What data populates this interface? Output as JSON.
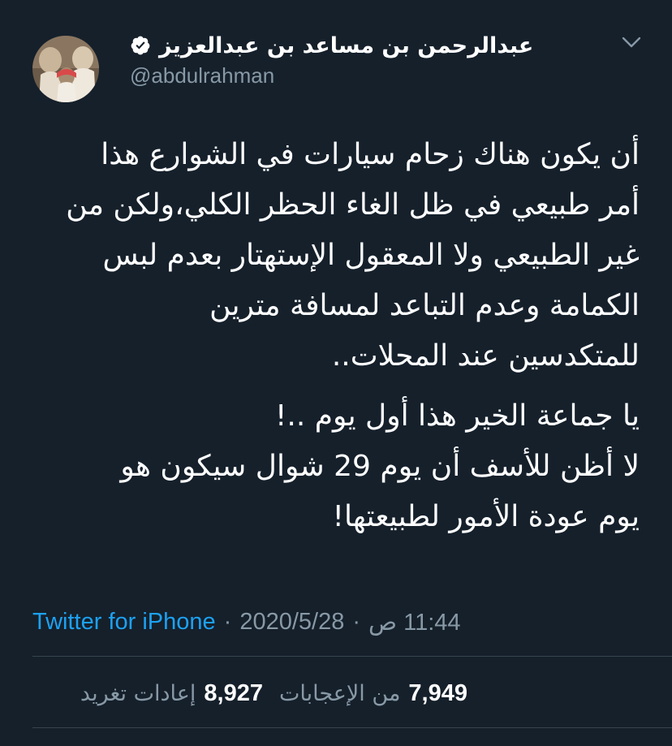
{
  "user": {
    "display_name": "عبدالرحمن بن مساعد بن عبدالعزيز",
    "handle": "@abdulrahman",
    "verified_icon": "verified-badge-icon",
    "menu_icon": "chevron-down-icon"
  },
  "tweet": {
    "paragraphs": [
      {
        "lines": [
          "أن يكون هناك زحام سيارات في الشوارع هذا",
          "أمر طبيعي في ظل الغاء الحظر الكلي،ولكن من",
          "غير الطبيعي ولا المعقول الإستهتار بعدم لبس",
          "الكمامة وعدم التباعد لمسافة مترين",
          "للمتكدسين عند المحلات.."
        ]
      },
      {
        "lines": [
          "يا جماعة الخير هذا أول يوم ..!",
          "لا أظن للأسف أن يوم 29 شوال سيكون   هو",
          "يوم عودة الأمور لطبيعتها!"
        ]
      }
    ]
  },
  "meta": {
    "time": "11:44 ص",
    "date": "2020/5/28",
    "source": "Twitter for iPhone",
    "separator": "·"
  },
  "stats": {
    "likes_count": "7,949",
    "likes_label": "من الإعجابات",
    "retweets_count": "8,927",
    "retweets_label": "إعادات تغريد"
  },
  "colors": {
    "background": "#15202b",
    "text_primary": "#ffffff",
    "text_secondary": "#8899a6",
    "link": "#1da1f2",
    "divider": "#38444d"
  }
}
